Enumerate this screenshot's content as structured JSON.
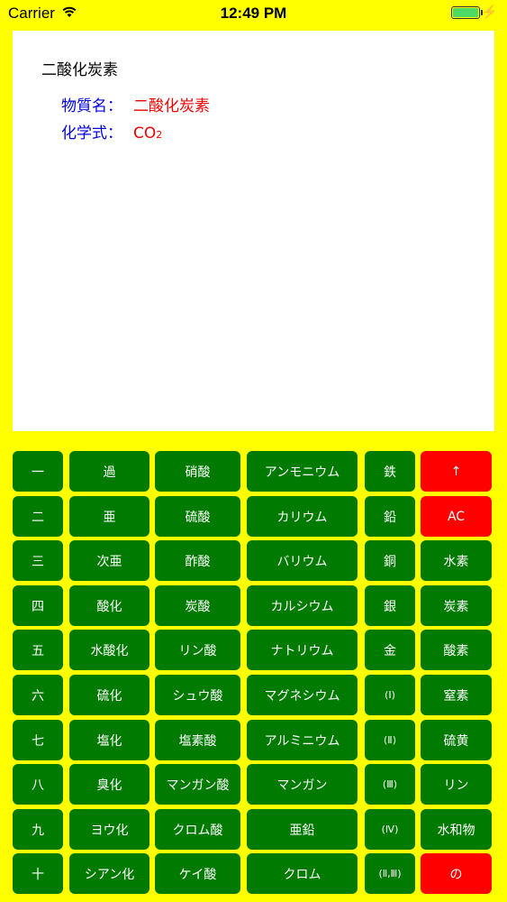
{
  "status": {
    "carrier": "Carrier",
    "time": "12:49 PM"
  },
  "display": {
    "title": "二酸化炭素",
    "name_label": "物質名：",
    "name_value": "二酸化炭素",
    "formula_label": "化学式：",
    "formula_main": "CO",
    "formula_sub": "2"
  },
  "keys": {
    "c1": [
      "一",
      "二",
      "三",
      "四",
      "五",
      "六",
      "七",
      "八",
      "九",
      "十"
    ],
    "c2": [
      "過",
      "亜",
      "次亜",
      "酸化",
      "水酸化",
      "硫化",
      "塩化",
      "臭化",
      "ヨウ化",
      "シアン化"
    ],
    "c3": [
      "硝酸",
      "硫酸",
      "酢酸",
      "炭酸",
      "リン酸",
      "シュウ酸",
      "塩素酸",
      "マンガン酸",
      "クロム酸",
      "ケイ酸"
    ],
    "c4": [
      "アンモニウム",
      "カリウム",
      "バリウム",
      "カルシウム",
      "ナトリウム",
      "マグネシウム",
      "アルミニウム",
      "マンガン",
      "亜鉛",
      "クロム"
    ],
    "c5": [
      "鉄",
      "鉛",
      "銅",
      "銀",
      "金",
      "(Ⅰ)",
      "(Ⅱ)",
      "(Ⅲ)",
      "(Ⅳ)",
      "(Ⅱ,Ⅲ)"
    ],
    "c6": [
      "↑",
      "AC",
      "水素",
      "炭素",
      "酸素",
      "窒素",
      "硫黄",
      "リン",
      "水和物",
      "の"
    ]
  },
  "colors": {
    "background": "#ffff00",
    "key": "#007a00",
    "key_special": "#ff0000",
    "label": "#0000dd",
    "value": "#ee0000"
  }
}
